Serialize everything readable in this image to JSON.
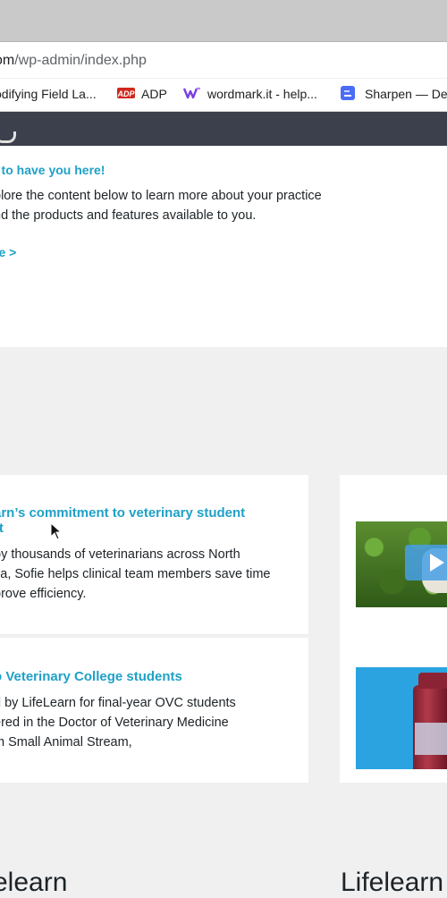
{
  "browser": {
    "url": {
      "host": "om",
      "path": "/wp-admin/index.php"
    },
    "bookmarks": [
      {
        "label": "odifying Field La...",
        "icon": "page-icon"
      },
      {
        "label": "ADP",
        "icon": "adp-logo-icon"
      },
      {
        "label": "wordmark.it - help...",
        "icon": "wordmark-icon"
      },
      {
        "label": "Sharpen — De",
        "icon": "sharpen-icon"
      }
    ]
  },
  "welcome": {
    "heading": "t to have you here!",
    "body_line1": "plore the content below to learn more about your practice",
    "body_line2": "nd the products and features available to you.",
    "more_link": "re >"
  },
  "cards": [
    {
      "title_line1": "arn’s commitment to veterinary student",
      "title_line2": "rt",
      "text_line1": "by thousands of veterinarians across North",
      "text_line2": "ca, Sofie helps clinical team members save time",
      "text_line3": "prove efficiency.",
      "media": "video-thumbnail"
    },
    {
      "title_line1": "o Veterinary College students",
      "text_line1": "d by LifeLearn for final-year OVC students",
      "text_line2": "ered in the Doctor of Veterinary Medicine",
      "text_line3": "m Small Animal Stream,",
      "media": "vaccine-image"
    }
  ],
  "brand": {
    "left": "elearn",
    "right": "Lifelearn"
  },
  "colors": {
    "link": "#1fa1c7",
    "adminbar": "#3c3f4c",
    "play": "#46a0e6"
  }
}
